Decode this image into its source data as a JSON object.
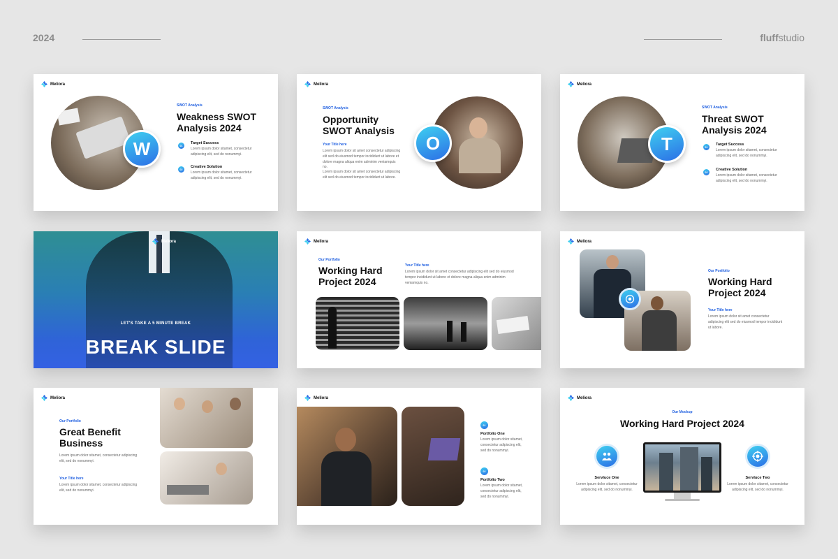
{
  "header": {
    "year": "2024",
    "brand_bold": "fluff",
    "brand_rest": "studio"
  },
  "brand_colors": {
    "accent": "#1f5fe0",
    "gradient_start": "#3fd0f0",
    "gradient_end": "#2c6fe6"
  },
  "logo_text": "Meliora",
  "lorem_long": "Lorem ipsum dolor sit amet consectetur adipiscing elit sed do eiusmod tempor incididunt ut labore et dolore magna aliqua enim adminim veniamquis no.",
  "lorem_short": "Lorem ipsum dolor sit amet consectetur adipiscing elit sed do eiusmod tempor incididunt ut labore.",
  "lorem_two": "Lorem ipsum dolor sitamet, consectetur adipiscing elit, sed do nonummyi.",
  "slides": {
    "weakness": {
      "kicker": "SWOT Analysis",
      "title": "Weakness SWOT Analysis 2024",
      "letter": "W",
      "points": [
        {
          "num": "01",
          "title": "Target Success"
        },
        {
          "num": "02",
          "title": "Creative Solution"
        }
      ]
    },
    "opportunity": {
      "kicker": "SWOT Analysis",
      "title": "Opportunity SWOT Analysis",
      "letter": "O",
      "subtitle": "Your Title here"
    },
    "threat": {
      "kicker": "SWOT Analysis",
      "title": "Threat SWOT Analysis 2024",
      "letter": "T",
      "points": [
        {
          "num": "01",
          "title": "Target Success"
        },
        {
          "num": "02",
          "title": "Creative Solution"
        }
      ]
    },
    "break": {
      "kicker": "LET'S TAKE A 5 MINUTE BREAK",
      "title": "BREAK SLIDE"
    },
    "portfolio": {
      "kicker": "Our Portfolio",
      "title": "Working Hard Project 2024",
      "subtitle": "Your Title here"
    },
    "working_hard": {
      "kicker": "Our Portfolio",
      "title": "Working Hard Project 2024",
      "subtitle": "Your Title here"
    },
    "benefit": {
      "kicker": "Our Portfolio",
      "title": "Great Benefit Business",
      "subtitle": "Your Title here"
    },
    "portfolio_items": {
      "items": [
        {
          "num": "01",
          "title": "Portfolio One"
        },
        {
          "num": "02",
          "title": "Portfolio Two"
        }
      ]
    },
    "mockup": {
      "kicker": "Our Mockup",
      "title": "Working Hard Project 2024",
      "services": [
        {
          "title": "Servluce One"
        },
        {
          "title": "Servluce Two"
        }
      ]
    }
  }
}
